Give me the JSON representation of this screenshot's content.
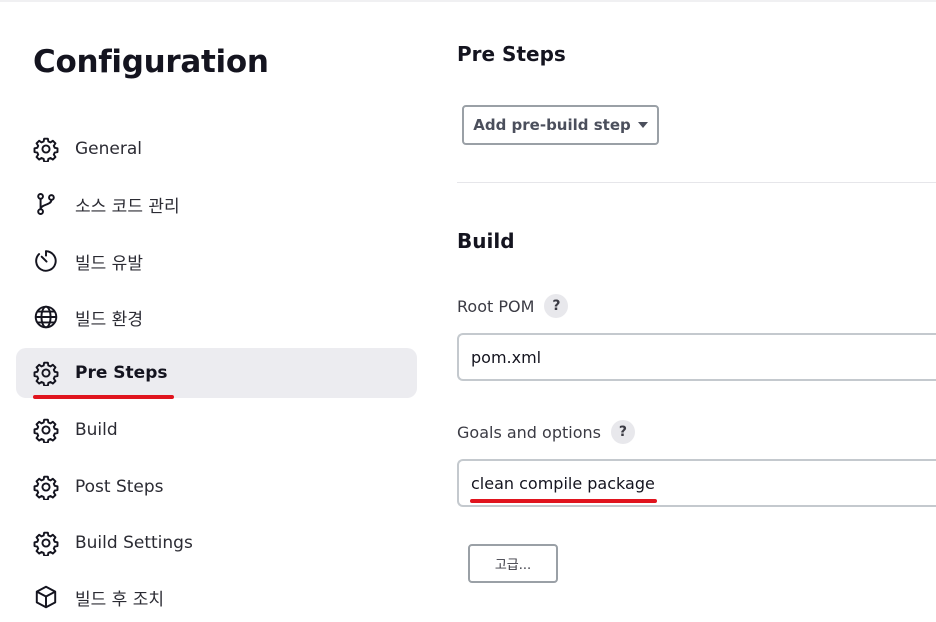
{
  "sidebar": {
    "title": "Configuration",
    "items": [
      {
        "label": "General",
        "icon": "gear-icon"
      },
      {
        "label": "소스 코드 관리",
        "icon": "git-branch-icon"
      },
      {
        "label": "빌드 유발",
        "icon": "timer-icon"
      },
      {
        "label": "빌드 환경",
        "icon": "globe-icon"
      },
      {
        "label": "Pre Steps",
        "icon": "gear-icon"
      },
      {
        "label": "Build",
        "icon": "gear-icon"
      },
      {
        "label": "Post Steps",
        "icon": "gear-icon"
      },
      {
        "label": "Build Settings",
        "icon": "gear-icon"
      },
      {
        "label": "빌드 후 조치",
        "icon": "cube-icon"
      }
    ],
    "active_item": "Pre Steps"
  },
  "pre_steps": {
    "title": "Pre Steps",
    "add_button_label": "Add pre-build step"
  },
  "build": {
    "title": "Build",
    "root_pom_label": "Root POM",
    "root_pom_value": "pom.xml",
    "goals_label": "Goals and options",
    "goals_value": "clean compile package",
    "help_symbol": "?",
    "advanced_button_label": "고급..."
  },
  "colors": {
    "highlight_underline": "#e0141e",
    "active_nav_bg": "#ececf0"
  }
}
